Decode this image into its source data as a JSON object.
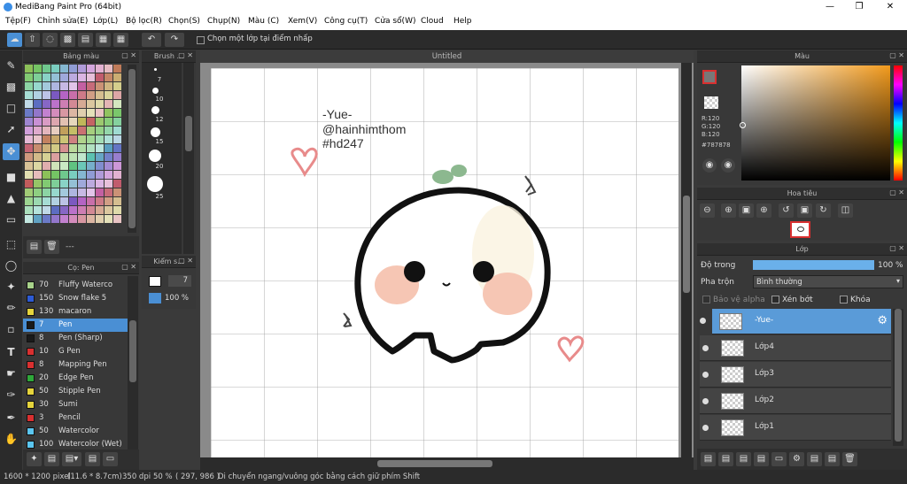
{
  "window": {
    "title": "MediBang Paint Pro (64bit)"
  },
  "menu": [
    "Tệp(F)",
    "Chỉnh sửa(E)",
    "Lớp(L)",
    "Bộ lọc(R)",
    "Chọn(S)",
    "Chụp(N)",
    "Màu (C)",
    "Xem(V)",
    "Công cụ(T)",
    "Cửa sổ(W)",
    "Cloud",
    "Help"
  ],
  "toolbar": {
    "checkbox_label": "Chọn một lớp tại điểm nhấp"
  },
  "panels": {
    "palette": "Bảng màu",
    "brush_size": "Brush ...",
    "brush": "Cọ: Pen",
    "brush_control": "Kiểm s...",
    "color": "Màu",
    "navigator": "Hoa tiêu",
    "layer": "Lớp",
    "canvas_tab": "Untitled"
  },
  "brush_sizes": [
    "7",
    "10",
    "12",
    "15",
    "20",
    "25"
  ],
  "palette_extra": "---",
  "brushes": [
    {
      "size": "70",
      "name": "Fluffy Waterco",
      "color": "#a8d38a"
    },
    {
      "size": "150",
      "name": "Snow flake 5",
      "color": "#2d5bd4"
    },
    {
      "size": "130",
      "name": "macaron",
      "color": "#e5d43c"
    },
    {
      "size": "7",
      "name": "Pen",
      "color": "#1a1a1a",
      "selected": true
    },
    {
      "size": "8",
      "name": "Pen (Sharp)",
      "color": "#1a1a1a"
    },
    {
      "size": "10",
      "name": "G Pen",
      "color": "#d93030"
    },
    {
      "size": "8",
      "name": "Mapping Pen",
      "color": "#d93030"
    },
    {
      "size": "20",
      "name": "Edge Pen",
      "color": "#2fa83a"
    },
    {
      "size": "50",
      "name": "Stipple Pen",
      "color": "#e5d43c"
    },
    {
      "size": "30",
      "name": "Sumi",
      "color": "#e5d43c"
    },
    {
      "size": "3",
      "name": "Pencil",
      "color": "#d93030"
    },
    {
      "size": "50",
      "name": "Watercolor",
      "color": "#5bc6f0"
    },
    {
      "size": "100",
      "name": "Watercolor (Wet)",
      "color": "#5bc6f0"
    }
  ],
  "brush_control": {
    "size": "7",
    "opacity": "100 %"
  },
  "color": {
    "r": "R:120",
    "g": "G:120",
    "b": "B:120",
    "hex": "#787878"
  },
  "layer": {
    "opacity_label": "Độ trong",
    "opacity_value": "100 %",
    "blend_label": "Pha trộn",
    "blend_value": "Bình thường",
    "protect_alpha": "Bảo vệ alpha",
    "clipping": "Xén bớt",
    "lock": "Khóa",
    "layers": [
      "-Yue-",
      "Lớp4",
      "Lớp3",
      "Lớp2",
      "Lớp1"
    ]
  },
  "canvas_text": {
    "line1": "-Yue-",
    "line2": "@hainhimthom",
    "line3": "#hd247"
  },
  "status": {
    "size": "1600 * 1200 pixel",
    "cm": "(11.6 * 8.7cm)",
    "dpi": "350 dpi",
    "zoom": "50 %",
    "coords": "( 297, 986 )",
    "hint": "Di chuyển ngang/vuông góc bằng cách giữ phím Shift"
  },
  "colors": {
    "accent": "#4a8fd4",
    "selected_layer": "#5a9bd8"
  }
}
